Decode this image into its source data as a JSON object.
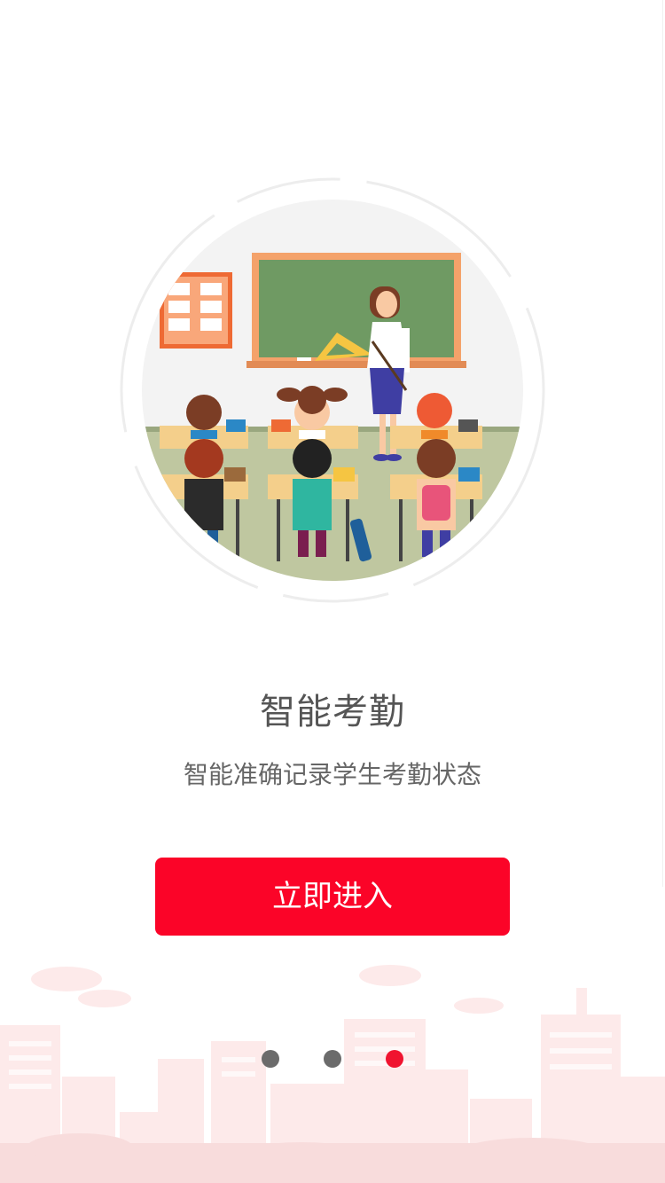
{
  "onboarding": {
    "title": "智能考勤",
    "subtitle": "智能准确记录学生考勤状态",
    "enter_button_label": "立即进入",
    "illustration_icon": "classroom-illustration",
    "pager": {
      "total": 3,
      "active_index": 2
    }
  },
  "colors": {
    "accent": "#fb0428",
    "dot_inactive": "#6b6b6b",
    "dot_active": "#f0132f",
    "title_text": "#555555",
    "subtitle_text": "#666666",
    "city_tint": "#fde7e7"
  }
}
